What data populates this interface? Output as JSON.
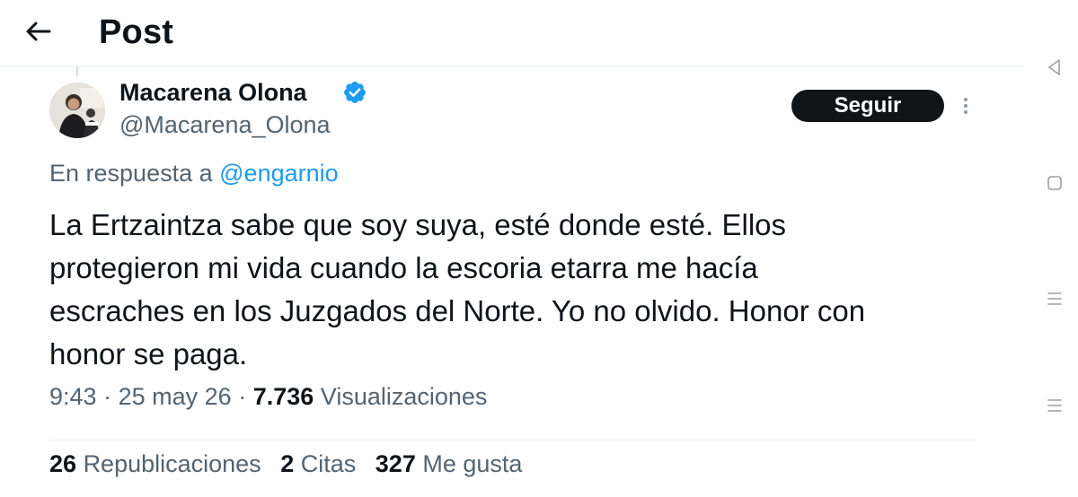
{
  "header": {
    "title": "Post"
  },
  "tweet": {
    "author_name": "Macarena Olona",
    "author_handle": "@Macarena_Olona",
    "follow_label": "Seguir",
    "reply_prefix": "En respuesta a",
    "reply_to": "@engarnio",
    "text_lines": [
      "La Ertzaintza sabe que soy suya, esté donde esté. Ellos",
      "protegieron mi vida cuando la escoria etarra me hacía",
      "escraches en los Juzgados del Norte. Yo no olvido. Honor con",
      "honor se paga."
    ],
    "time": "9:43",
    "date": "25 may 26",
    "views_count": "7.736",
    "views_label": "Visualizaciones",
    "separator": "·"
  },
  "stats": {
    "reposts_count": "26",
    "reposts_label": "Republicaciones",
    "quotes_count": "2",
    "quotes_label": "Citas",
    "likes_count": "327",
    "likes_label": "Me gusta"
  },
  "icons": {
    "back": "arrow-left-icon",
    "verified": "verified-badge-icon",
    "more": "more-vertical-icon",
    "nav_back": "triangle-back-icon",
    "nav_home": "square-home-icon",
    "nav_menu": "menu-lines-icon"
  },
  "colors": {
    "text_primary": "#0f1419",
    "text_secondary": "#536471",
    "link": "#1d9bf0",
    "verified": "#1d9bf0",
    "button_bg": "#0f1419",
    "button_text": "#ffffff",
    "divider": "#eff3f4"
  }
}
